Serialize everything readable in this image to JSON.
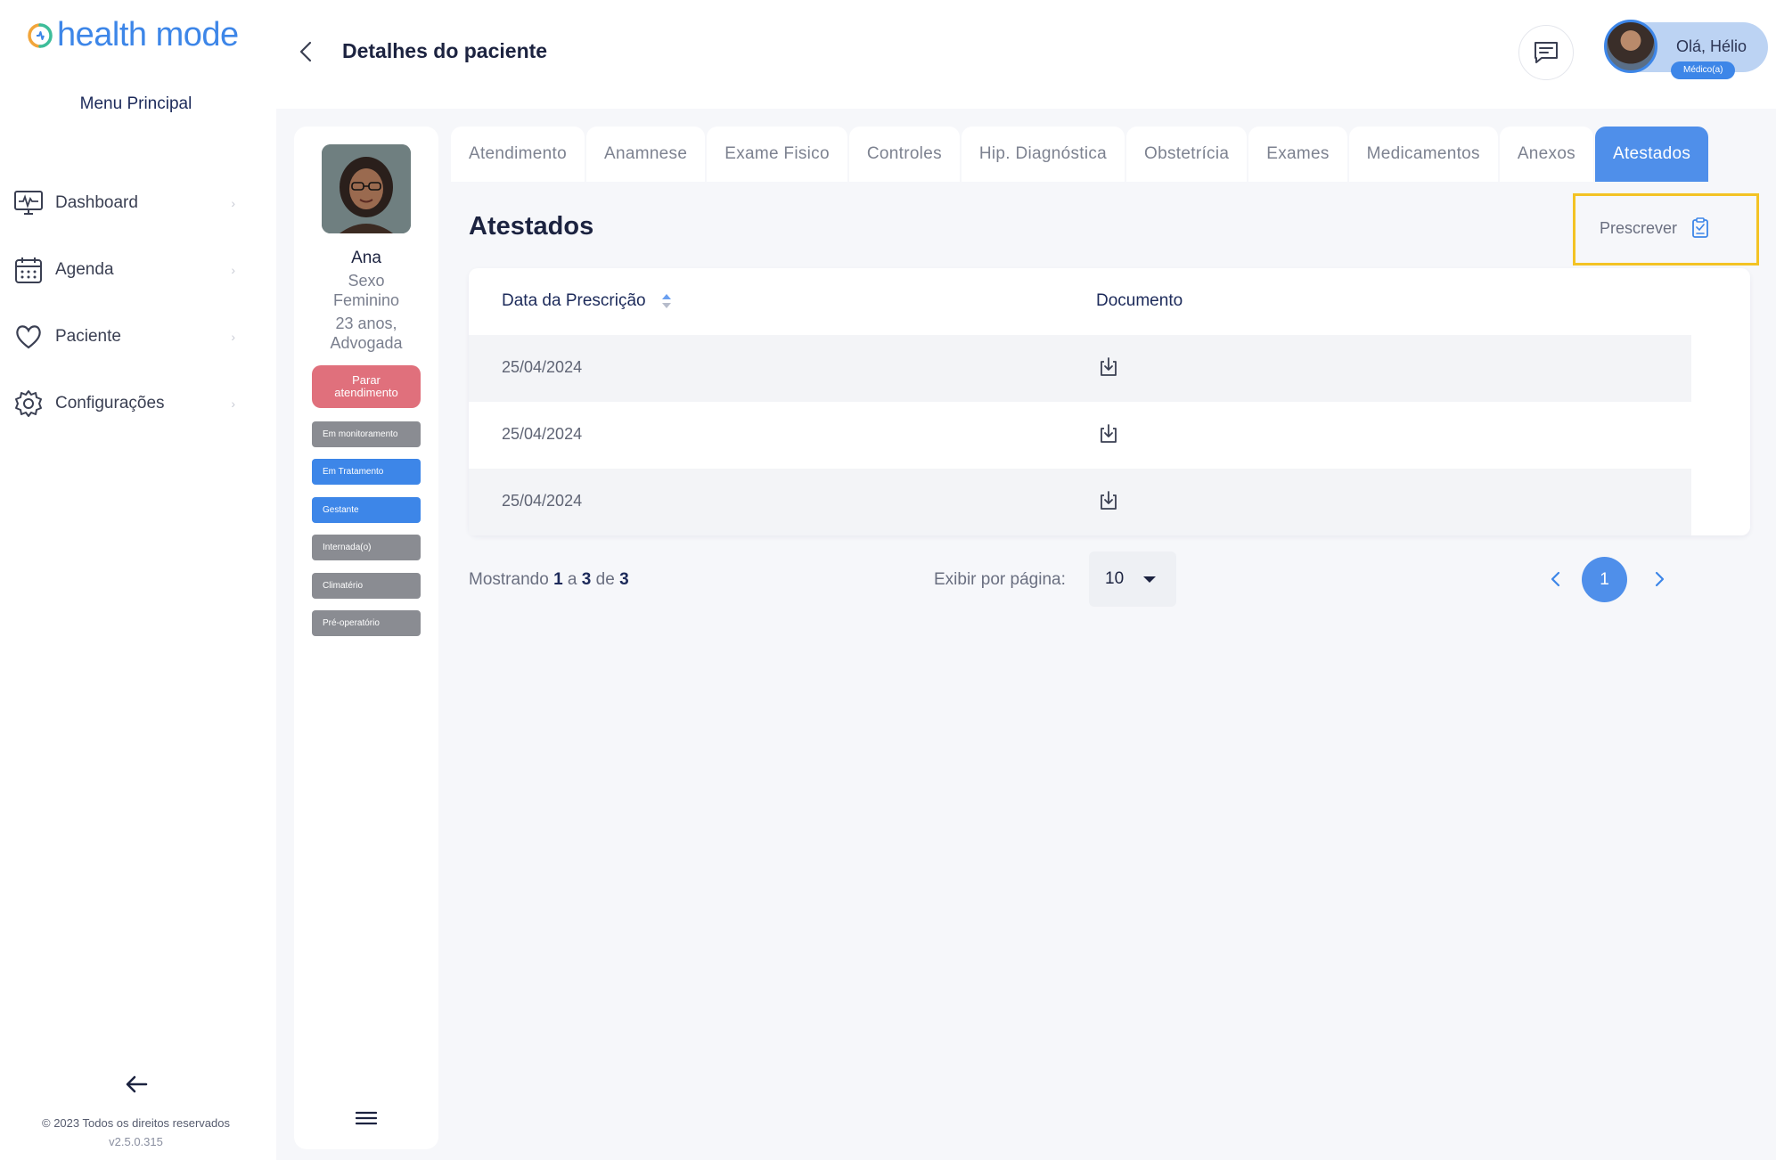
{
  "brand": {
    "logo_text": "health mode",
    "logo_icon": "health-mode-logo-icon",
    "accent_color": "#3d86e8"
  },
  "sidebar": {
    "menu_title": "Menu Principal",
    "items": [
      {
        "label": "Dashboard",
        "icon": "monitor-icon"
      },
      {
        "label": "Agenda",
        "icon": "calendar-icon"
      },
      {
        "label": "Paciente",
        "icon": "heart-icon"
      },
      {
        "label": "Configurações",
        "icon": "gear-icon"
      }
    ],
    "collapse_icon": "arrow-left-icon",
    "copyright": "© 2023 Todos os direitos reservados",
    "version": "v2.5.0.315"
  },
  "header": {
    "back_icon": "chevron-left-icon",
    "title": "Detalhes do paciente",
    "chat_icon": "chat-icon",
    "user": {
      "greeting": "Olá, Hélio",
      "role": "Médico(a)"
    }
  },
  "patient": {
    "name": "Ana",
    "sex_line1": "Sexo",
    "sex_line2": "Feminino",
    "age_line": "23 anos,",
    "occupation": "Advogada",
    "stop_button_line1": "Parar",
    "stop_button_line2": "atendimento",
    "tags": [
      {
        "label": "Em monitoramento",
        "color": "#8a8c92"
      },
      {
        "label": "Em Tratamento",
        "color": "#3d86e8"
      },
      {
        "label": "Gestante",
        "color": "#3d86e8"
      },
      {
        "label": "Internada(o)",
        "color": "#8a8c92"
      },
      {
        "label": "Climatério",
        "color": "#8a8c92"
      },
      {
        "label": "Pré-operatório",
        "color": "#8a8c92"
      }
    ],
    "menu_icon": "hamburger-icon"
  },
  "tabs": [
    {
      "label": "Atendimento",
      "active": false
    },
    {
      "label": "Anamnese",
      "active": false
    },
    {
      "label": "Exame Fisico",
      "active": false
    },
    {
      "label": "Controles",
      "active": false
    },
    {
      "label": "Hip. Diagnóstica",
      "active": false
    },
    {
      "label": "Obstetrícia",
      "active": false
    },
    {
      "label": "Exames",
      "active": false
    },
    {
      "label": "Medicamentos",
      "active": false
    },
    {
      "label": "Anexos",
      "active": false
    },
    {
      "label": "Atestados",
      "active": true
    }
  ],
  "section": {
    "title": "Atestados",
    "prescribe_label": "Prescrever",
    "prescribe_icon": "clipboard-check-icon"
  },
  "table": {
    "columns": [
      "Data da Prescrição",
      "Documento"
    ],
    "sort_icon": "sort-icon",
    "rows": [
      {
        "date": "25/04/2024",
        "doc_icon": "download-icon"
      },
      {
        "date": "25/04/2024",
        "doc_icon": "download-icon"
      },
      {
        "date": "25/04/2024",
        "doc_icon": "download-icon"
      }
    ]
  },
  "pagination": {
    "showing_prefix": "Mostrando",
    "from": "1",
    "sep_a": "a",
    "to": "3",
    "sep_de": "de",
    "total": "3",
    "per_page_label": "Exibir por página:",
    "per_page_value": "10",
    "current_page": "1"
  }
}
